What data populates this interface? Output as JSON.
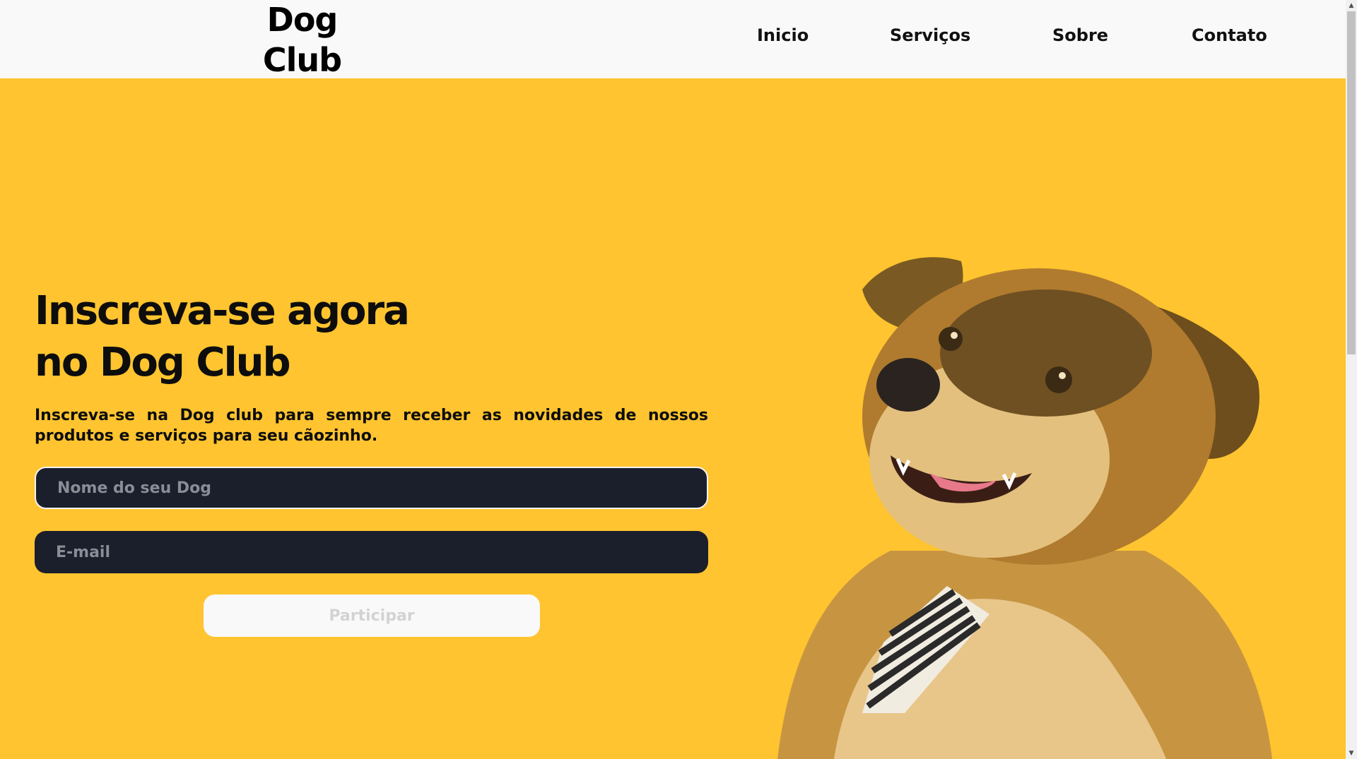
{
  "header": {
    "logo_line1": "Dog",
    "logo_line2": "Club",
    "nav": [
      {
        "label": "Inicio"
      },
      {
        "label": "Serviços"
      },
      {
        "label": "Sobre"
      },
      {
        "label": "Contato"
      }
    ]
  },
  "hero": {
    "title_line1": "Inscreva-se agora",
    "title_line2": "no Dog Club",
    "description": "Inscreva-se na Dog club para sempre receber as novidades de nossos produtos e serviços para seu cãozinho.",
    "form": {
      "name_placeholder": "Nome do seu Dog",
      "name_value": "",
      "email_placeholder": "E-mail",
      "email_value": "",
      "submit_label": "Participar"
    },
    "image_icon": "dog-with-tie-image"
  },
  "colors": {
    "background": "#FFC42F",
    "header": "#F9F9F9",
    "field": "#1B1E2B",
    "button": "#F9F9F9"
  }
}
